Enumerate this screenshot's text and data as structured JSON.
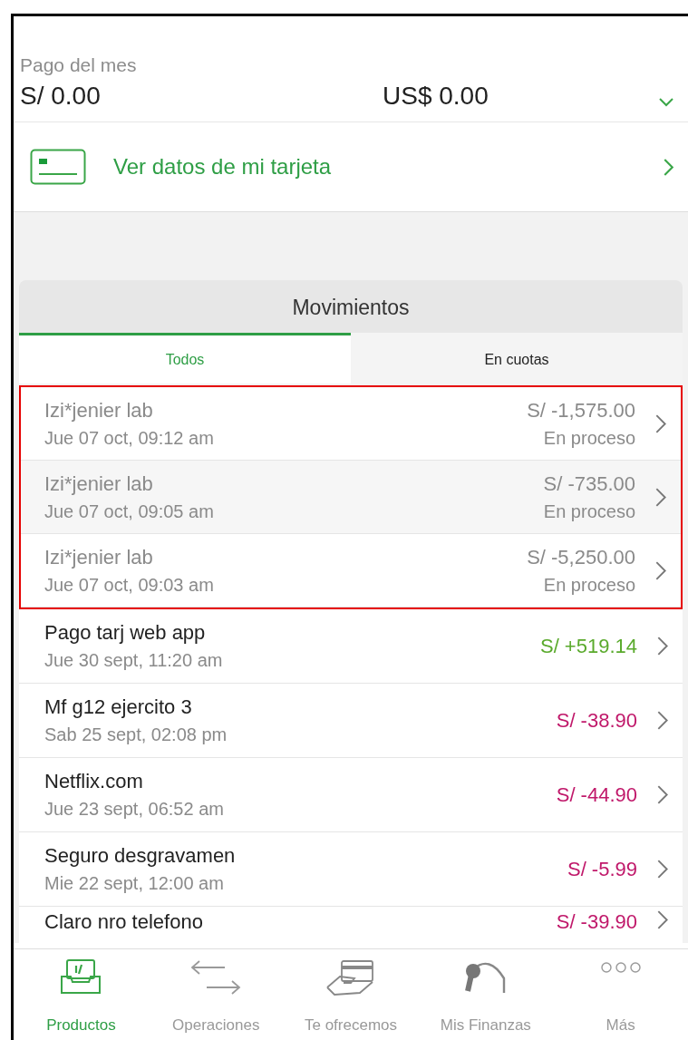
{
  "payment": {
    "label": "Pago del mes",
    "amount_pen": "S/ 0.00",
    "amount_usd": "US$ 0.00",
    "expanded": false
  },
  "card_link": {
    "label": "Ver datos de mi tarjeta"
  },
  "movements": {
    "title": "Movimientos",
    "tabs": [
      {
        "label": "Todos",
        "selected": true
      },
      {
        "label": "En cuotas",
        "selected": false
      }
    ],
    "highlight_pending": true,
    "rows": [
      {
        "kind": "pending",
        "name": "Izi*jenier lab",
        "date": "Jue 07 oct, 09:12 am",
        "amount": "S/ -1,575.00",
        "status": "En proceso"
      },
      {
        "kind": "pending",
        "name": "Izi*jenier lab",
        "date": "Jue 07 oct, 09:05 am",
        "amount": "S/ -735.00",
        "status": "En proceso"
      },
      {
        "kind": "pending",
        "name": "Izi*jenier lab",
        "date": "Jue 07 oct, 09:03 am",
        "amount": "S/ -5,250.00",
        "status": "En proceso"
      },
      {
        "kind": "credit",
        "name": "Pago tarj web app",
        "date": "Jue 30 sept, 11:20 am",
        "amount": "S/ +519.14"
      },
      {
        "kind": "debit",
        "name": "Mf g12 ejercito 3",
        "date": "Sab 25 sept, 02:08 pm",
        "amount": "S/ -38.90"
      },
      {
        "kind": "debit",
        "name": "Netflix.com",
        "date": "Jue 23 sept, 06:52 am",
        "amount": "S/ -44.90"
      },
      {
        "kind": "debit",
        "name": "Seguro desgravamen",
        "date": "Mie 22 sept, 12:00 am",
        "amount": "S/ -5.99"
      },
      {
        "kind": "debit",
        "name": "Claro nro telefono",
        "amount": "S/ -39.90"
      }
    ]
  },
  "nav": [
    {
      "label": "Productos",
      "kind": "products",
      "selected": true
    },
    {
      "label": "Operaciones",
      "kind": "transfer",
      "selected": false
    },
    {
      "label": "Te ofrecemos",
      "kind": "offer",
      "selected": false
    },
    {
      "label": "Mis Finanzas",
      "kind": "gauge",
      "selected": false
    },
    {
      "label": "Más",
      "kind": "more",
      "selected": false
    }
  ]
}
